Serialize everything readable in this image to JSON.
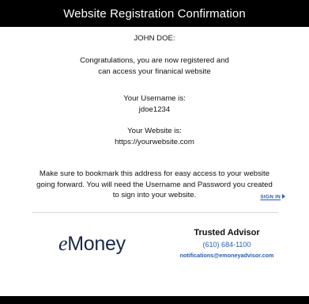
{
  "header": {
    "title": "Website Registration Confirmation"
  },
  "greeting": "JOHN DOE:",
  "congrats": {
    "line1": "Congratulations, you are now registered and",
    "line2": "can access your finanical website"
  },
  "username": {
    "label": "Your Username is:",
    "value": "jdoe1234"
  },
  "website": {
    "label": "Your Website is:",
    "value": "https://yourwebsite.com"
  },
  "bookmark": {
    "line1": "Make sure to bookmark this address for easy access to your website",
    "line2": "going forward. You will need the Username and Password you created",
    "line3": "to sign into your website."
  },
  "signin": {
    "label": "SIGN IN"
  },
  "logo": {
    "e": "e",
    "rest": "Money"
  },
  "advisor": {
    "name": "Trusted Advisor",
    "phone": "(610) 684-1100",
    "email": "notifications@emoneyadvisor.com"
  },
  "colors": {
    "header_bg": "#000000",
    "link": "#2a5db0",
    "logo": "#1b2a4a"
  }
}
